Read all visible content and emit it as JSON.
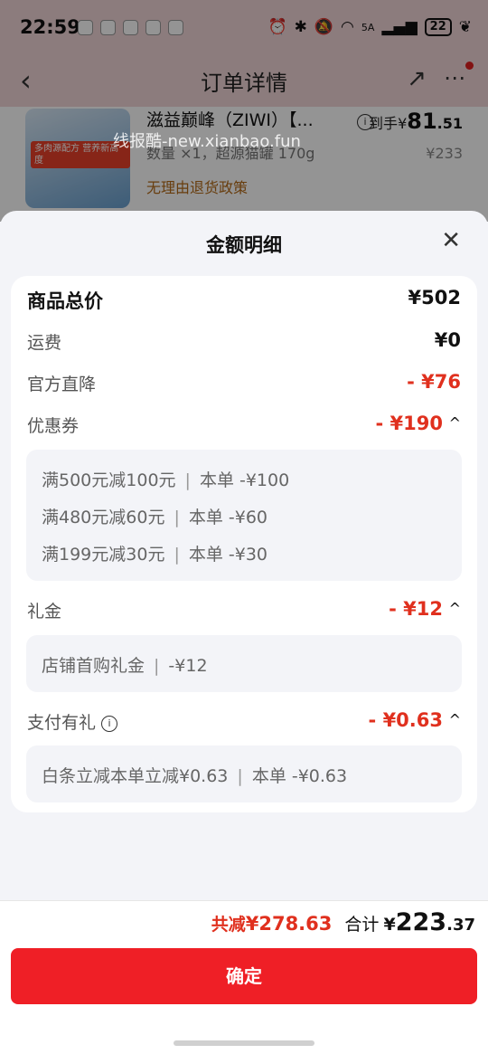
{
  "status_bar": {
    "time": "22:59",
    "network": "5A",
    "battery": "22"
  },
  "nav": {
    "back": "‹",
    "title": "订单详情",
    "share": "↗",
    "more": "⋯"
  },
  "product": {
    "name": "滋益巅峰（ZIWI）【...",
    "qty": "数量 ×1，超源猫罐 170g",
    "policy": "无理由退货政策",
    "price_label": "到手",
    "price_symbol": "¥",
    "price_int": "81",
    "price_dec": ".51",
    "orig_price": "¥233",
    "image_tag": "多肉源配方 营养新高度"
  },
  "watermark": "线报酷-new.xianbao.fun",
  "sheet": {
    "title": "金额明细",
    "close": "✕",
    "total": {
      "label": "商品总价",
      "value": "¥502"
    },
    "shipping": {
      "label": "运费",
      "value": "¥0"
    },
    "official": {
      "label": "官方直降",
      "value": "- ¥76"
    },
    "coupon": {
      "label": "优惠券",
      "value": "- ¥190",
      "items": [
        {
          "cond": "满500元减100元",
          "sep": "|",
          "detail": "本单 -¥100"
        },
        {
          "cond": "满480元减60元",
          "sep": "|",
          "detail": "本单 -¥60"
        },
        {
          "cond": "满199元减30元",
          "sep": "|",
          "detail": "本单 -¥30"
        }
      ]
    },
    "gift": {
      "label": "礼金",
      "value": "- ¥12",
      "items": [
        {
          "cond": "店铺首购礼金",
          "sep": "|",
          "detail": "-¥12"
        }
      ]
    },
    "pay": {
      "label": "支付有礼",
      "value": "- ¥0.63",
      "items": [
        {
          "cond": "白条立减本单立减¥0.63",
          "sep": "|",
          "detail": "本单 -¥0.63"
        }
      ]
    },
    "chevron": "^"
  },
  "bottom": {
    "save_label": "共减",
    "save_value": "¥278.63",
    "total_label": "合计",
    "total_symbol": "¥",
    "total_int": "223",
    "total_dec": ".37",
    "confirm": "确定"
  },
  "colors": {
    "accent": "#ef1f26",
    "discount": "#e0301e"
  }
}
